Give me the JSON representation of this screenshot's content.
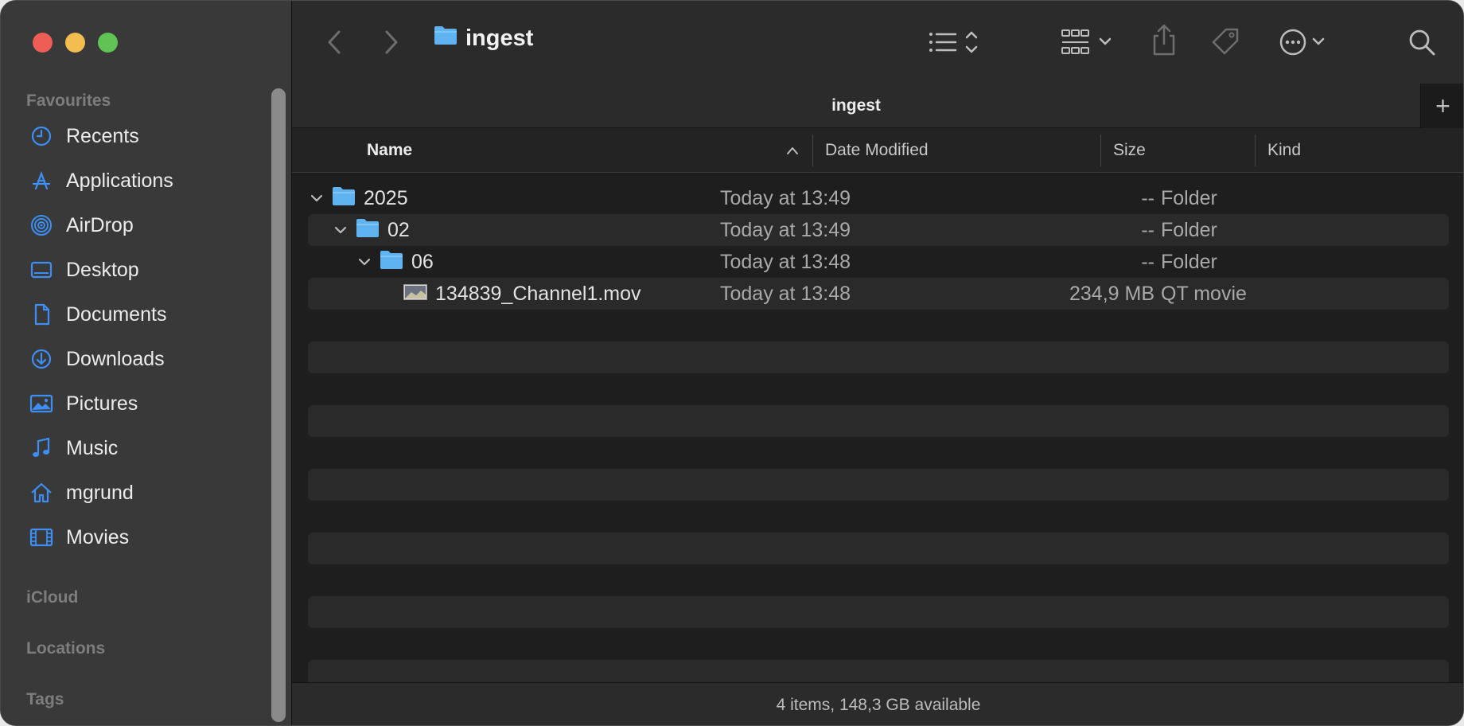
{
  "sidebar": {
    "sections": {
      "favourites": "Favourites",
      "icloud": "iCloud",
      "locations": "Locations",
      "tags": "Tags"
    },
    "items": [
      {
        "label": "Recents",
        "icon": "clock-icon"
      },
      {
        "label": "Applications",
        "icon": "applications-icon"
      },
      {
        "label": "AirDrop",
        "icon": "airdrop-icon"
      },
      {
        "label": "Desktop",
        "icon": "desktop-icon"
      },
      {
        "label": "Documents",
        "icon": "document-icon"
      },
      {
        "label": "Downloads",
        "icon": "download-icon"
      },
      {
        "label": "Pictures",
        "icon": "pictures-icon"
      },
      {
        "label": "Music",
        "icon": "music-icon"
      },
      {
        "label": "mgrund",
        "icon": "home-icon"
      },
      {
        "label": "Movies",
        "icon": "film-icon"
      }
    ],
    "accent_color": "#3d8ff5"
  },
  "toolbar": {
    "title": "ingest"
  },
  "tabbar": {
    "tab_label": "ingest",
    "add_label": "+"
  },
  "columns": {
    "name": "Name",
    "date": "Date Modified",
    "size": "Size",
    "kind": "Kind"
  },
  "rows": [
    {
      "name": "2025",
      "date": "Today at 13:49",
      "size": "--",
      "kind": "Folder",
      "type": "folder",
      "level": 0,
      "expanded": true
    },
    {
      "name": "02",
      "date": "Today at 13:49",
      "size": "--",
      "kind": "Folder",
      "type": "folder",
      "level": 1,
      "expanded": true
    },
    {
      "name": "06",
      "date": "Today at 13:48",
      "size": "--",
      "kind": "Folder",
      "type": "folder",
      "level": 2,
      "expanded": true
    },
    {
      "name": "134839_Channel1.mov",
      "date": "Today at 13:48",
      "size": "234,9 MB",
      "kind": "QT movie",
      "type": "movie",
      "level": 3,
      "expanded": false
    }
  ],
  "status": "4 items, 148,3 GB available",
  "colors": {
    "folder": "#5fb3f0",
    "close": "#ee5e56",
    "minimize": "#f4bd4f",
    "maximize": "#5fc454"
  }
}
